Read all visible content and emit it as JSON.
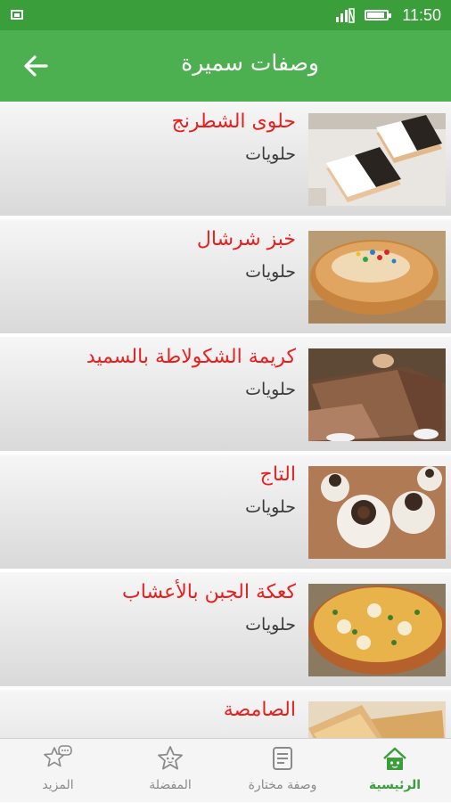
{
  "status_bar": {
    "time": "11:50"
  },
  "app_bar": {
    "title": "وصفات سميرة"
  },
  "recipes": [
    {
      "title": "حلوى الشطرنج",
      "category": "حلويات"
    },
    {
      "title": "خبز شرشال",
      "category": "حلويات"
    },
    {
      "title": "كريمة الشكولاطة بالسميد",
      "category": "حلويات"
    },
    {
      "title": "التاج",
      "category": "حلويات"
    },
    {
      "title": "كعكة الجبن بالأعشاب",
      "category": "حلويات"
    },
    {
      "title": "الصامصة",
      "category": ""
    }
  ],
  "bottom_nav": {
    "items": [
      {
        "label": "الرئيسية",
        "icon": "home-icon",
        "active": true
      },
      {
        "label": "وصفة مختارة",
        "icon": "featured-recipe-icon",
        "active": false
      },
      {
        "label": "المفضلة",
        "icon": "favorites-star-icon",
        "active": false
      },
      {
        "label": "المزيد",
        "icon": "more-chat-icon",
        "active": false
      }
    ]
  },
  "colors": {
    "status_bar": "#3a9e3a",
    "app_bar": "#4caf50",
    "title_red": "#e81f1f",
    "active_nav": "#3a9e3a"
  }
}
